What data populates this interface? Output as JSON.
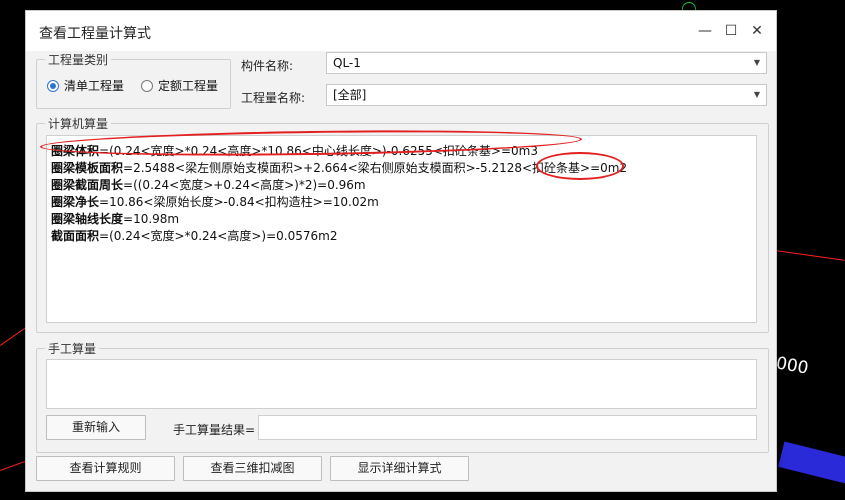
{
  "background": {
    "corner_text": "000"
  },
  "dialog": {
    "title": "查看工程量计算式",
    "window_controls": {
      "minimize": "—",
      "maximize": "☐",
      "close": "✕"
    }
  },
  "quantity_type": {
    "group_title": "工程量类别",
    "options": [
      {
        "label": "清单工程量",
        "selected": true
      },
      {
        "label": "定额工程量",
        "selected": false
      }
    ]
  },
  "component": {
    "label": "构件名称:",
    "value": "QL-1"
  },
  "quantity_name": {
    "label": "工程量名称:",
    "value": "[全部]"
  },
  "computer_calc": {
    "group_title": "计算机算量",
    "lines": [
      {
        "name": "圈梁体积",
        "formula": "=(0.24<宽度>*0.24<高度>*10.86<中心线长度>)-0.6255<扣砼条基>=0m3"
      },
      {
        "name": "圈梁模板面积",
        "formula": "=2.5488<梁左侧原始支模面积>+2.664<梁右侧原始支模面积>-5.2128<扣砼条基>=0m2"
      },
      {
        "name": "圈梁截面周长",
        "formula": "=((0.24<宽度>+0.24<高度>)*2)=0.96m"
      },
      {
        "name": "圈梁净长",
        "formula": "=10.86<梁原始长度>-0.84<扣构造柱>=10.02m"
      },
      {
        "name": "圈梁轴线长度",
        "formula": "=10.98m"
      },
      {
        "name": "截面面积",
        "formula": "=(0.24<宽度>*0.24<高度>)=0.0576m2"
      }
    ]
  },
  "manual_calc": {
    "group_title": "手工算量",
    "reenter_button": "重新输入",
    "result_label": "手工算量结果="
  },
  "footer_buttons": {
    "view_rules": "查看计算规则",
    "view_3d": "查看三维扣减图",
    "show_detail": "显示详细计算式"
  }
}
